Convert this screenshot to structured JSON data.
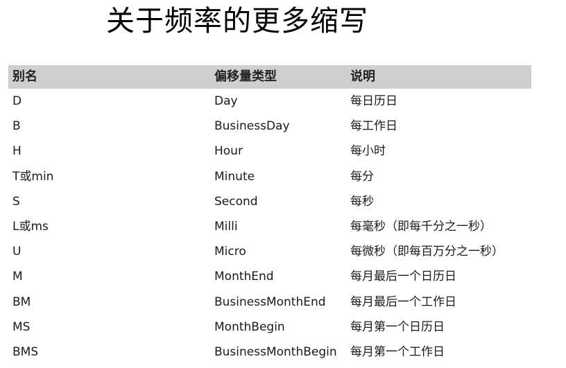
{
  "title": "关于频率的更多缩写",
  "table": {
    "headers": {
      "alias": "别名",
      "offset_type": "偏移量类型",
      "description": "说明"
    },
    "rows": [
      {
        "alias": "D",
        "offset_type": "Day",
        "description": "每日历日"
      },
      {
        "alias": "B",
        "offset_type": "BusinessDay",
        "description": "每工作日"
      },
      {
        "alias": "H",
        "offset_type": "Hour",
        "description": "每小时"
      },
      {
        "alias": "T或min",
        "offset_type": "Minute",
        "description": "每分"
      },
      {
        "alias": "S",
        "offset_type": "Second",
        "description": "每秒"
      },
      {
        "alias": "L或ms",
        "offset_type": "Milli",
        "description": "每毫秒（即每千分之一秒）"
      },
      {
        "alias": "U",
        "offset_type": "Micro",
        "description": "每微秒（即每百万分之一秒）"
      },
      {
        "alias": "M",
        "offset_type": "MonthEnd",
        "description": "每月最后一个日历日"
      },
      {
        "alias": "BM",
        "offset_type": "BusinessMonthEnd",
        "description": "每月最后一个工作日"
      },
      {
        "alias": "MS",
        "offset_type": "MonthBegin",
        "description": "每月第一个日历日"
      },
      {
        "alias": "BMS",
        "offset_type": "BusinessMonthBegin",
        "description": "每月第一个工作日"
      }
    ]
  }
}
